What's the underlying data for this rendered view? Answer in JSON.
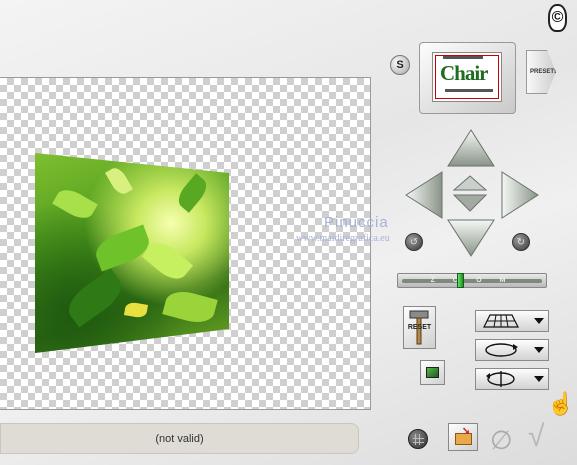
{
  "status": {
    "text": "(not valid)"
  },
  "watermark": {
    "name": "Pinuccia",
    "site": "www.maidiregrafica.eu"
  },
  "logo": {
    "glyph": "©"
  },
  "s_button": {
    "label": "S"
  },
  "thumbnail": {
    "text": "Chair"
  },
  "presets": {
    "label": "PRESETS"
  },
  "zoom": {
    "label": "Z O O M",
    "level": 0.42
  },
  "reset": {
    "label": "RESET"
  },
  "icons": {
    "arrow_up": "arrow-up-icon",
    "arrow_down": "arrow-down-icon",
    "arrow_left": "arrow-left-icon",
    "arrow_right": "arrow-right-icon",
    "help": "hand-pointer-icon",
    "cancel": "cancel-icon",
    "ok": "checkmark-icon"
  },
  "colors": {
    "status_bg": "#dedcd4",
    "checker": "#cfcfcf",
    "zoom_thumb": "#2fbf2f"
  }
}
